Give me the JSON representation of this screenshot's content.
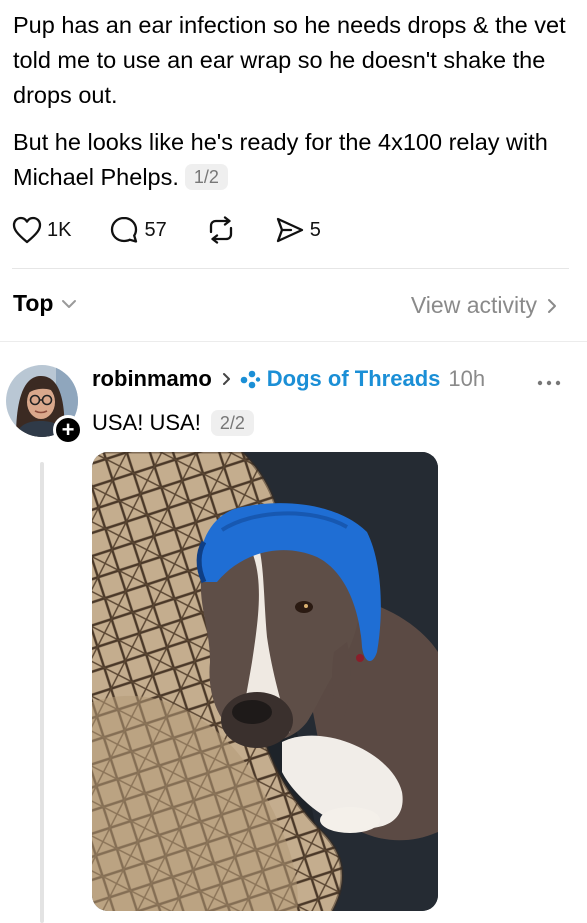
{
  "post": {
    "paragraph1": "Pup has an ear infection so he needs drops & the vet told me to use an ear wrap so he doesn't shake the drops out.",
    "paragraph2": "But he looks like he's ready for the 4x100 relay with Michael Phelps.",
    "page_indicator": "1/2"
  },
  "actions": {
    "likes": "1K",
    "replies": "57",
    "shares": "5"
  },
  "sort": {
    "label": "Top",
    "view_activity": "View activity"
  },
  "reply": {
    "username": "robinmamo",
    "community": "Dogs of Threads",
    "time": "10h",
    "text": "USA! USA!",
    "page_indicator": "2/2"
  },
  "colors": {
    "accent": "#1b8fd6",
    "muted": "#8a8a8a",
    "pill_bg": "#efefef"
  },
  "icons": [
    "heart-icon",
    "comment-icon",
    "repost-icon",
    "send-icon",
    "chevron-down-icon",
    "chevron-right-icon",
    "community-icon",
    "more-icon",
    "plus-icon"
  ]
}
